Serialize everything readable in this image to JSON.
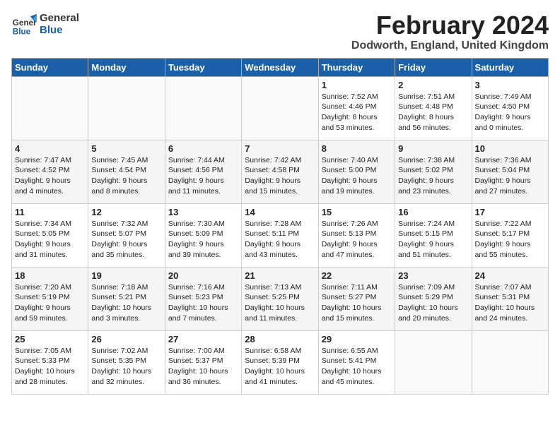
{
  "header": {
    "logo_line1": "General",
    "logo_line2": "Blue",
    "month": "February 2024",
    "location": "Dodworth, England, United Kingdom"
  },
  "weekdays": [
    "Sunday",
    "Monday",
    "Tuesday",
    "Wednesday",
    "Thursday",
    "Friday",
    "Saturday"
  ],
  "weeks": [
    [
      {
        "day": "",
        "info": ""
      },
      {
        "day": "",
        "info": ""
      },
      {
        "day": "",
        "info": ""
      },
      {
        "day": "",
        "info": ""
      },
      {
        "day": "1",
        "info": "Sunrise: 7:52 AM\nSunset: 4:46 PM\nDaylight: 8 hours\nand 53 minutes."
      },
      {
        "day": "2",
        "info": "Sunrise: 7:51 AM\nSunset: 4:48 PM\nDaylight: 8 hours\nand 56 minutes."
      },
      {
        "day": "3",
        "info": "Sunrise: 7:49 AM\nSunset: 4:50 PM\nDaylight: 9 hours\nand 0 minutes."
      }
    ],
    [
      {
        "day": "4",
        "info": "Sunrise: 7:47 AM\nSunset: 4:52 PM\nDaylight: 9 hours\nand 4 minutes."
      },
      {
        "day": "5",
        "info": "Sunrise: 7:45 AM\nSunset: 4:54 PM\nDaylight: 9 hours\nand 8 minutes."
      },
      {
        "day": "6",
        "info": "Sunrise: 7:44 AM\nSunset: 4:56 PM\nDaylight: 9 hours\nand 11 minutes."
      },
      {
        "day": "7",
        "info": "Sunrise: 7:42 AM\nSunset: 4:58 PM\nDaylight: 9 hours\nand 15 minutes."
      },
      {
        "day": "8",
        "info": "Sunrise: 7:40 AM\nSunset: 5:00 PM\nDaylight: 9 hours\nand 19 minutes."
      },
      {
        "day": "9",
        "info": "Sunrise: 7:38 AM\nSunset: 5:02 PM\nDaylight: 9 hours\nand 23 minutes."
      },
      {
        "day": "10",
        "info": "Sunrise: 7:36 AM\nSunset: 5:04 PM\nDaylight: 9 hours\nand 27 minutes."
      }
    ],
    [
      {
        "day": "11",
        "info": "Sunrise: 7:34 AM\nSunset: 5:05 PM\nDaylight: 9 hours\nand 31 minutes."
      },
      {
        "day": "12",
        "info": "Sunrise: 7:32 AM\nSunset: 5:07 PM\nDaylight: 9 hours\nand 35 minutes."
      },
      {
        "day": "13",
        "info": "Sunrise: 7:30 AM\nSunset: 5:09 PM\nDaylight: 9 hours\nand 39 minutes."
      },
      {
        "day": "14",
        "info": "Sunrise: 7:28 AM\nSunset: 5:11 PM\nDaylight: 9 hours\nand 43 minutes."
      },
      {
        "day": "15",
        "info": "Sunrise: 7:26 AM\nSunset: 5:13 PM\nDaylight: 9 hours\nand 47 minutes."
      },
      {
        "day": "16",
        "info": "Sunrise: 7:24 AM\nSunset: 5:15 PM\nDaylight: 9 hours\nand 51 minutes."
      },
      {
        "day": "17",
        "info": "Sunrise: 7:22 AM\nSunset: 5:17 PM\nDaylight: 9 hours\nand 55 minutes."
      }
    ],
    [
      {
        "day": "18",
        "info": "Sunrise: 7:20 AM\nSunset: 5:19 PM\nDaylight: 9 hours\nand 59 minutes."
      },
      {
        "day": "19",
        "info": "Sunrise: 7:18 AM\nSunset: 5:21 PM\nDaylight: 10 hours\nand 3 minutes."
      },
      {
        "day": "20",
        "info": "Sunrise: 7:16 AM\nSunset: 5:23 PM\nDaylight: 10 hours\nand 7 minutes."
      },
      {
        "day": "21",
        "info": "Sunrise: 7:13 AM\nSunset: 5:25 PM\nDaylight: 10 hours\nand 11 minutes."
      },
      {
        "day": "22",
        "info": "Sunrise: 7:11 AM\nSunset: 5:27 PM\nDaylight: 10 hours\nand 15 minutes."
      },
      {
        "day": "23",
        "info": "Sunrise: 7:09 AM\nSunset: 5:29 PM\nDaylight: 10 hours\nand 20 minutes."
      },
      {
        "day": "24",
        "info": "Sunrise: 7:07 AM\nSunset: 5:31 PM\nDaylight: 10 hours\nand 24 minutes."
      }
    ],
    [
      {
        "day": "25",
        "info": "Sunrise: 7:05 AM\nSunset: 5:33 PM\nDaylight: 10 hours\nand 28 minutes."
      },
      {
        "day": "26",
        "info": "Sunrise: 7:02 AM\nSunset: 5:35 PM\nDaylight: 10 hours\nand 32 minutes."
      },
      {
        "day": "27",
        "info": "Sunrise: 7:00 AM\nSunset: 5:37 PM\nDaylight: 10 hours\nand 36 minutes."
      },
      {
        "day": "28",
        "info": "Sunrise: 6:58 AM\nSunset: 5:39 PM\nDaylight: 10 hours\nand 41 minutes."
      },
      {
        "day": "29",
        "info": "Sunrise: 6:55 AM\nSunset: 5:41 PM\nDaylight: 10 hours\nand 45 minutes."
      },
      {
        "day": "",
        "info": ""
      },
      {
        "day": "",
        "info": ""
      }
    ]
  ]
}
